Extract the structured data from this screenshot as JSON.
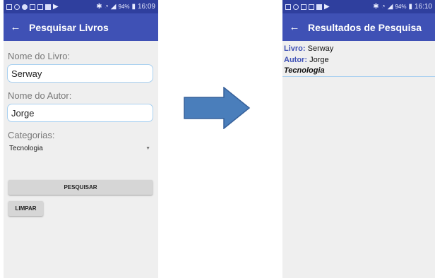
{
  "colors": {
    "statusbar": "#2f3f9e",
    "appbar": "#3f51b5",
    "arrow": "#4a7ebb",
    "input_border": "#a8d0f0"
  },
  "left_screen": {
    "statusbar": {
      "battery": "94%",
      "time": "16:09"
    },
    "appbar": {
      "back_icon": "arrow-left-icon",
      "title": "Pesquisar Livros"
    },
    "form": {
      "book_label": "Nome do Livro:",
      "book_value": "Serway",
      "author_label": "Nome do Autor:",
      "author_value": "Jorge",
      "category_label": "Categorias:",
      "category_selected": "Tecnologia"
    },
    "buttons": {
      "search": "PESQUISAR",
      "clear": "LIMPAR"
    }
  },
  "right_screen": {
    "statusbar": {
      "battery": "94%",
      "time": "16:10"
    },
    "appbar": {
      "back_icon": "arrow-left-icon",
      "title": "Resultados de Pesquisa"
    },
    "result": {
      "book_key": "Livro:",
      "book_value": "Serway",
      "author_key": "Autor:",
      "author_value": "Jorge",
      "category": "Tecnologia"
    }
  }
}
